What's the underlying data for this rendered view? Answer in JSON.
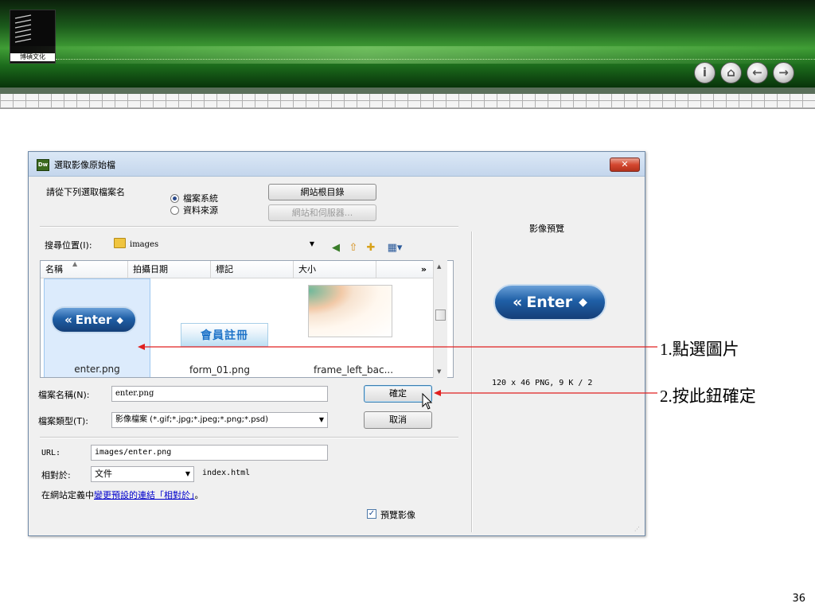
{
  "slide": {
    "logo_text": "博碩文化",
    "nav_buttons": [
      "i",
      "⌂",
      "←",
      "→"
    ],
    "page_number": "36"
  },
  "dialog": {
    "app_icon": "Dw",
    "title": "選取影像原始檔",
    "close_label": "✕",
    "source_prompt": "請從下列選取檔案名",
    "radio_file_system": "檔案系統",
    "radio_data_source": "資料來源",
    "site_root_button": "網站根目錄",
    "server_button": "網站和伺服器...",
    "look_in_label": "搜尋位置(I):",
    "look_in_value": "images",
    "columns": [
      "名稱",
      "拍攝日期",
      "標記",
      "大小",
      "»"
    ],
    "files": [
      {
        "name": "enter.png",
        "thumb_text": "Enter"
      },
      {
        "name": "form_01.png",
        "thumb_text": "會員註冊"
      },
      {
        "name": "frame_left_bac...",
        "thumb_text": ""
      }
    ],
    "filename_label": "檔案名稱(N):",
    "filename_value": "enter.png",
    "filetype_label": "檔案類型(T):",
    "filetype_value": "影像檔案 (*.gif;*.jpg;*.jpeg;*.png;*.psd)",
    "ok_button": "確定",
    "cancel_button": "取消",
    "url_label": "URL:",
    "url_value": "images/enter.png",
    "relative_label": "相對於:",
    "relative_value": "文件",
    "relative_file": "index.html",
    "site_note_prefix": "在網站定義中",
    "site_note_link": "變更預設的連結「相對於」",
    "site_note_suffix": "。",
    "preview_checkbox_label": "預覽影像",
    "preview_title": "影像預覽",
    "preview_image_text": "Enter",
    "preview_info": "120 x 46 PNG, 9 K / 2"
  },
  "callouts": {
    "step1": "1.點選圖片",
    "step2": "2.按此鈕確定"
  },
  "colors": {
    "callout_line": "#e02020",
    "selection": "#dcebfc",
    "link": "#0000cc"
  }
}
